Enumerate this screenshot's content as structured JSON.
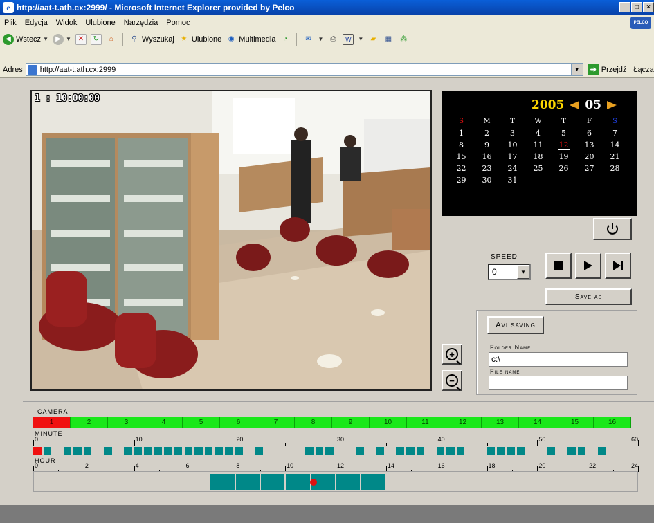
{
  "window": {
    "title": "http://aat-t.ath.cx:2999/ - Microsoft Internet Explorer provided by Pelco",
    "minimize": "_",
    "maximize": "□",
    "close": "×"
  },
  "menu": {
    "items": [
      "Plik",
      "Edycja",
      "Widok",
      "Ulubione",
      "Narzędzia",
      "Pomoc"
    ],
    "brand": "PELCO"
  },
  "toolbar": {
    "back": "Wstecz",
    "search": "Wyszukaj",
    "favorites": "Ulubione",
    "media": "Multimedia"
  },
  "address": {
    "label": "Adres",
    "url": "http://aat-t.ath.cx:2999",
    "go": "Przejdź",
    "links": "Łącza"
  },
  "video": {
    "timestamp": "1 : 10:00:00"
  },
  "calendar": {
    "year": "2005",
    "month": "05",
    "weekdays": [
      "S",
      "M",
      "T",
      "W",
      "T",
      "F",
      "S"
    ],
    "weekend_colors": {
      "sunday": "#e81010",
      "saturday": "#2040e0"
    },
    "days": [
      [
        "1",
        "2",
        "3",
        "4",
        "5",
        "6",
        "7"
      ],
      [
        "8",
        "9",
        "10",
        "11",
        "12",
        "13",
        "14"
      ],
      [
        "15",
        "16",
        "17",
        "18",
        "19",
        "20",
        "21"
      ],
      [
        "22",
        "23",
        "24",
        "25",
        "26",
        "27",
        "28"
      ],
      [
        "29",
        "30",
        "31",
        "",
        "",
        "",
        ""
      ]
    ],
    "selected_day": "12",
    "selected_color": "#e81010"
  },
  "controls": {
    "speed_label": "SPEED",
    "speed_value": "0",
    "save_as": "Save as",
    "avi_saving": "Avi saving",
    "folder_label": "Folder Name",
    "folder_value": "c:\\",
    "file_label": "File name",
    "file_value": ""
  },
  "timeline": {
    "camera_label": "CAMERA",
    "minute_label": "MINUTE",
    "hour_label": "HOUR",
    "cameras": [
      "1",
      "2",
      "3",
      "4",
      "5",
      "6",
      "7",
      "8",
      "9",
      "10",
      "11",
      "12",
      "13",
      "14",
      "15",
      "16"
    ],
    "active_camera": "1",
    "minute_ticks": [
      "0",
      "10",
      "20",
      "30",
      "40",
      "50",
      "60"
    ],
    "hour_ticks": [
      "0",
      "2",
      "4",
      "6",
      "8",
      "10",
      "12",
      "14",
      "16",
      "18",
      "20",
      "22",
      "24"
    ],
    "minute_recorded": [
      0,
      1,
      3,
      4,
      5,
      7,
      9,
      10,
      11,
      12,
      13,
      14,
      15,
      16,
      17,
      18,
      19,
      20,
      22,
      27,
      28,
      29,
      32,
      34,
      36,
      37,
      38,
      40,
      41,
      42,
      45,
      46,
      47,
      48,
      51,
      53,
      54,
      56
    ],
    "minute_current": 0,
    "hour_recorded": [
      7,
      8,
      9,
      10,
      11,
      12,
      13
    ],
    "hour_current": 10,
    "colors": {
      "recorded": "#008888",
      "active": "#f01010",
      "camera": "#1ae81a"
    }
  }
}
